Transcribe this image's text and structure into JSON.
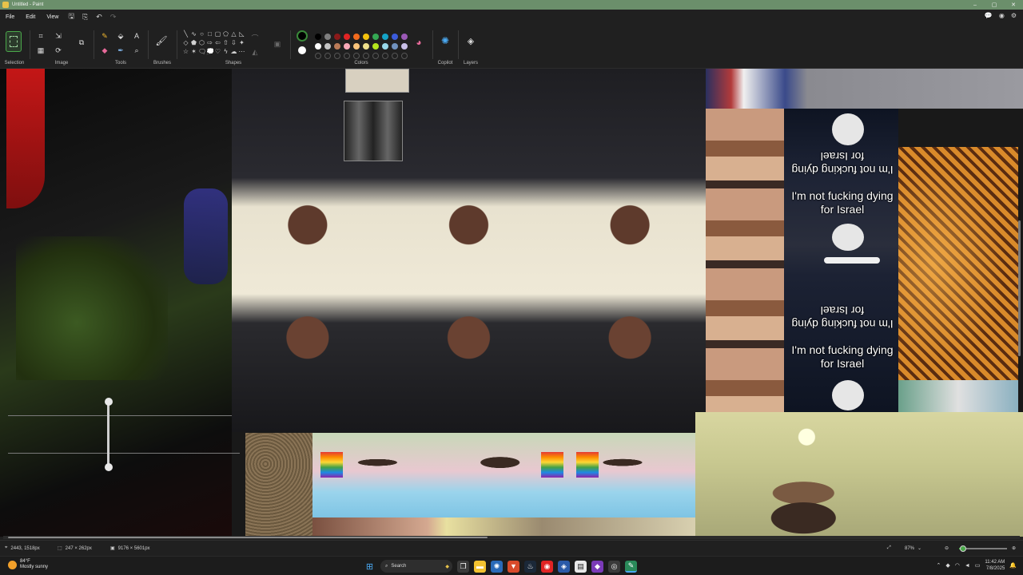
{
  "window": {
    "title": "Untitled - Paint",
    "title_color": "#6b8f6b",
    "controls": [
      "–",
      "▢",
      "✕"
    ]
  },
  "menu": {
    "file": "File",
    "edit": "Edit",
    "view": "View"
  },
  "ribbon": {
    "groups": {
      "selection": "Selection",
      "image": "Image",
      "tools": "Tools",
      "brushes": "Brushes",
      "shapes": "Shapes",
      "colors": "Colors",
      "copilot": "Copilot",
      "layers": "Layers"
    },
    "primary_color": "#000000",
    "secondary_color": "#ffffff",
    "palette_row1": [
      "#000000",
      "#7f7f7f",
      "#8b1a1a",
      "#e02424",
      "#f26b1d",
      "#f4c20d",
      "#34a853",
      "#14a3c7",
      "#3b5bdb",
      "#9b59b6"
    ],
    "palette_row2": [
      "#ffffff",
      "#c3c3c3",
      "#b97a57",
      "#f7a8b8",
      "#f8c37a",
      "#eee08b",
      "#b5e61d",
      "#99d9ea",
      "#7092be",
      "#c8bfe7"
    ]
  },
  "canvas": {
    "captions": {
      "top_flipped": "I'm not fucking dying for Israel",
      "top_normal": "I'm not fucking dying for Israel",
      "bottom_flipped": "I'm not fucking dying for Israel",
      "bottom_normal": "I'm not fucking dying for Israel"
    }
  },
  "status": {
    "cursor_pos": "2443, 1518px",
    "selection_size": "247 × 262px",
    "canvas_size": "9176 × 5601px",
    "zoom": "87%"
  },
  "taskbar": {
    "weather_temp": "84°F",
    "weather_desc": "Mostly sunny",
    "search_placeholder": "Search",
    "time": "11:42 AM",
    "date": "7/8/2025"
  }
}
